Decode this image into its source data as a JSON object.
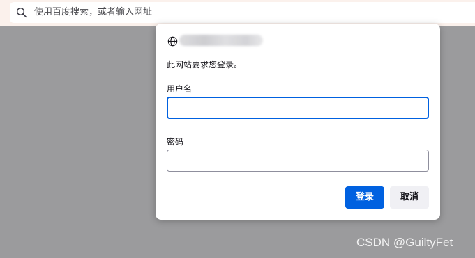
{
  "address_bar": {
    "icon": "search-icon",
    "placeholder": "使用百度搜索，或者输入网址"
  },
  "auth_dialog": {
    "site_icon": "globe-icon",
    "site_host_blurred": true,
    "message": "此网站要求您登录。",
    "username": {
      "label": "用户名",
      "value": "",
      "focused": true
    },
    "password": {
      "label": "密码",
      "value": ""
    },
    "login_button": "登录",
    "cancel_button": "取消"
  },
  "watermark": "CSDN @GuiltyFet",
  "colors": {
    "overlay": "#9b9b9d",
    "accent": "#0061e0",
    "address_bar_bg": "#fbf1ec",
    "dialog_bg": "#ffffff"
  }
}
